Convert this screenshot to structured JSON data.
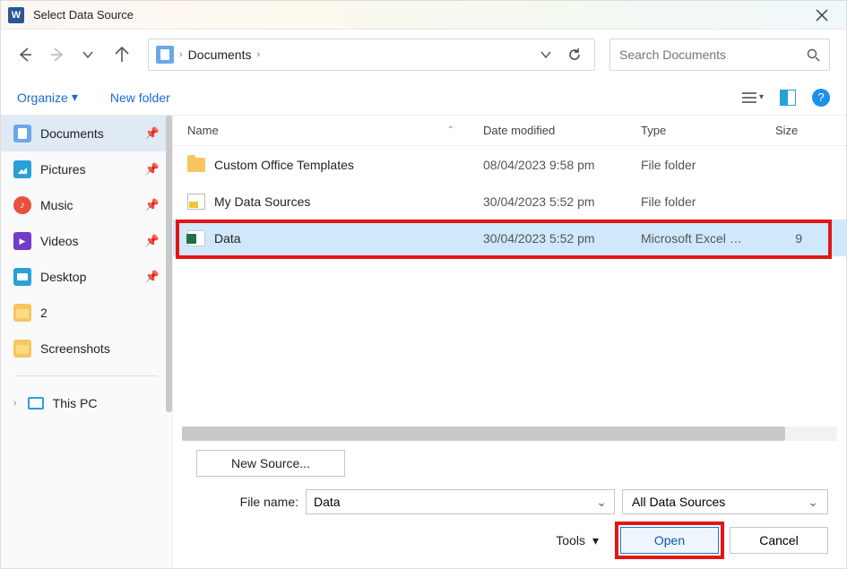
{
  "window": {
    "title": "Select Data Source"
  },
  "nav": {
    "location": "Documents"
  },
  "search": {
    "placeholder": "Search Documents"
  },
  "toolbar": {
    "organize": "Organize",
    "new_folder": "New folder"
  },
  "sidebar": {
    "items": [
      {
        "label": "Documents"
      },
      {
        "label": "Pictures"
      },
      {
        "label": "Music"
      },
      {
        "label": "Videos"
      },
      {
        "label": "Desktop"
      },
      {
        "label": "2"
      },
      {
        "label": "Screenshots"
      }
    ],
    "this_pc": "This PC"
  },
  "columns": {
    "name": "Name",
    "date": "Date modified",
    "type": "Type",
    "size": "Size"
  },
  "files": [
    {
      "name": "Custom Office Templates",
      "date": "08/04/2023 9:58 pm",
      "type": "File folder",
      "size": ""
    },
    {
      "name": "My Data Sources",
      "date": "30/04/2023 5:52 pm",
      "type": "File folder",
      "size": ""
    },
    {
      "name": "Data",
      "date": "30/04/2023 5:52 pm",
      "type": "Microsoft Excel W...",
      "size": "9"
    }
  ],
  "footer": {
    "new_source": "New Source...",
    "file_name_label": "File name:",
    "file_name_value": "Data",
    "filter": "All Data Sources",
    "tools": "Tools",
    "open": "Open",
    "cancel": "Cancel"
  }
}
